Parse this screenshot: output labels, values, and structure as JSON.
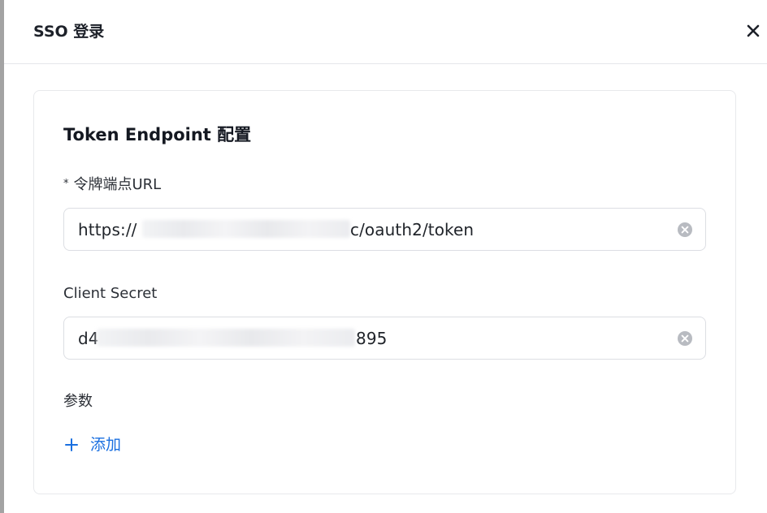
{
  "dialog": {
    "title": "SSO 登录",
    "close_icon": "close-icon"
  },
  "card": {
    "title": "Token Endpoint 配置",
    "token_url": {
      "required_mark": "*",
      "label": "令牌端点URL",
      "value_prefix": "https://",
      "value_suffix": "c/oauth2/token",
      "clear_icon": "clear-circle-icon"
    },
    "client_secret": {
      "label": "Client Secret",
      "value_prefix": "d4",
      "value_suffix": "895",
      "clear_icon": "clear-circle-icon"
    },
    "params": {
      "label": "参数",
      "add_label": "添加",
      "add_icon": "plus-icon"
    }
  },
  "colors": {
    "accent": "#1a6fe0",
    "border": "#dcdee3",
    "text": "#1f2329"
  }
}
